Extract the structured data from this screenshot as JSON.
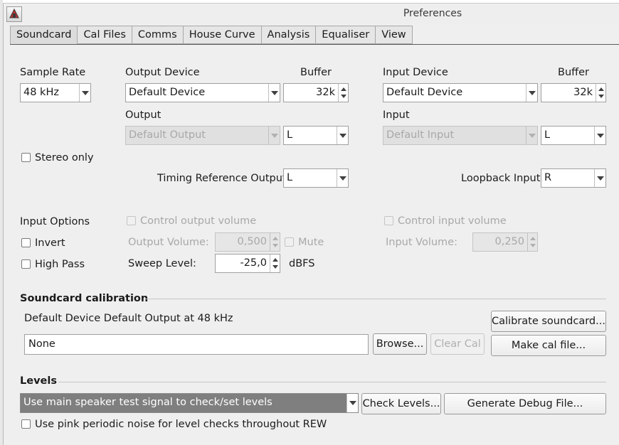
{
  "window": {
    "title": "Preferences",
    "app_icon": "rew-app-icon"
  },
  "tabs": [
    {
      "label": "Soundcard",
      "active": true
    },
    {
      "label": "Cal Files",
      "active": false
    },
    {
      "label": "Comms",
      "active": false
    },
    {
      "label": "House Curve",
      "active": false
    },
    {
      "label": "Analysis",
      "active": false
    },
    {
      "label": "Equaliser",
      "active": false
    },
    {
      "label": "View",
      "active": false
    }
  ],
  "soundcard": {
    "sample_rate": {
      "label": "Sample Rate",
      "value": "48 kHz"
    },
    "output_device": {
      "label": "Output Device",
      "value": "Default Device"
    },
    "output_buffer": {
      "label": "Buffer",
      "value": "32k"
    },
    "input_device": {
      "label": "Input Device",
      "value": "Default Device"
    },
    "input_buffer": {
      "label": "Buffer",
      "value": "32k"
    },
    "output": {
      "label": "Output",
      "device_value": "Default Output",
      "channel": "L"
    },
    "input": {
      "label": "Input",
      "device_value": "Default Input",
      "channel": "L"
    },
    "stereo_only": {
      "label": "Stereo only",
      "checked": false
    },
    "timing_reference": {
      "label": "Timing Reference Output",
      "value": "L"
    },
    "loopback": {
      "label": "Loopback Input",
      "value": "R"
    }
  },
  "input_options": {
    "heading": "Input Options",
    "invert": {
      "label": "Invert",
      "checked": false
    },
    "high_pass": {
      "label": "High Pass",
      "checked": false
    },
    "control_output_volume": {
      "label": "Control output volume",
      "checked": false
    },
    "output_volume": {
      "label": "Output Volume:",
      "value": "0,500"
    },
    "mute": {
      "label": "Mute",
      "checked": false
    },
    "sweep_level": {
      "label": "Sweep Level:",
      "value": "-25,0",
      "unit": "dBFS"
    },
    "control_input_volume": {
      "label": "Control input volume",
      "checked": false
    },
    "input_volume": {
      "label": "Input Volume:",
      "value": "0,250"
    }
  },
  "calibration": {
    "heading": "Soundcard calibration",
    "description": "Default Device Default Output at 48 kHz",
    "file_value": "None",
    "calibrate_button": "Calibrate soundcard...",
    "browse_button": "Browse...",
    "clear_button": "Clear Cal",
    "make_cal_button": "Make cal file..."
  },
  "levels": {
    "heading": "Levels",
    "mode_value": "Use main speaker test signal to check/set levels",
    "check_button": "Check Levels...",
    "debug_button": "Generate Debug File...",
    "pink_noise": {
      "label": "Use pink periodic noise for level checks throughout REW",
      "checked": false
    }
  },
  "colors": {
    "window_bg": "#efefef",
    "selection_bg": "#7f7f7f",
    "disabled_text": "#a8a8a8"
  }
}
